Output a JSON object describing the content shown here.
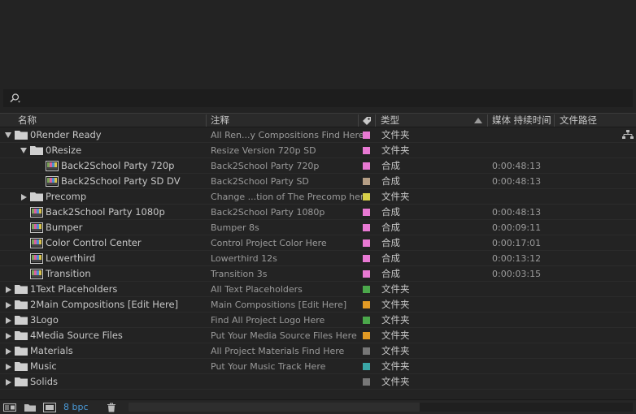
{
  "colors": {
    "pink": "#e879d3",
    "tan": "#b59e85",
    "yellow": "#d8d14a",
    "green": "#4ba84b",
    "orange": "#e29a24",
    "gray": "#777777",
    "teal": "#3aa6a6"
  },
  "header": {
    "name": "名称",
    "comment": "注释",
    "type": "类型",
    "duration": "媒体 持续时间",
    "path": "文件路径"
  },
  "rows": [
    {
      "depth": 0,
      "expand": "open",
      "kind": "folder",
      "name": "0Render Ready",
      "comment": "All Ren...y Compositions Find Here",
      "color": "pink",
      "type": "文件夹",
      "duration": ""
    },
    {
      "depth": 1,
      "expand": "open",
      "kind": "folder",
      "name": "0Resize",
      "comment": "Resize Version 720p SD",
      "color": "pink",
      "type": "文件夹",
      "duration": ""
    },
    {
      "depth": 2,
      "expand": "none",
      "kind": "comp",
      "name": "Back2School Party 720p",
      "comment": "Back2School Party 720p",
      "color": "pink",
      "type": "合成",
      "duration": "0:00:48:13"
    },
    {
      "depth": 2,
      "expand": "none",
      "kind": "comp",
      "name": "Back2School Party SD DV",
      "comment": "Back2School Party SD",
      "color": "tan",
      "type": "合成",
      "duration": "0:00:48:13"
    },
    {
      "depth": 1,
      "expand": "closed",
      "kind": "folder",
      "name": "Precomp",
      "comment": "Change ...tion of The Precomp here",
      "color": "yellow",
      "type": "文件夹",
      "duration": ""
    },
    {
      "depth": 1,
      "expand": "none",
      "kind": "comp",
      "name": "Back2School Party 1080p",
      "comment": "Back2School Party 1080p",
      "color": "pink",
      "type": "合成",
      "duration": "0:00:48:13"
    },
    {
      "depth": 1,
      "expand": "none",
      "kind": "comp",
      "name": "Bumper",
      "comment": "Bumper 8s",
      "color": "pink",
      "type": "合成",
      "duration": "0:00:09:11"
    },
    {
      "depth": 1,
      "expand": "none",
      "kind": "comp",
      "name": "Color Control Center",
      "comment": "Control Project Color Here",
      "color": "pink",
      "type": "合成",
      "duration": "0:00:17:01"
    },
    {
      "depth": 1,
      "expand": "none",
      "kind": "comp",
      "name": "Lowerthird",
      "comment": "Lowerthird 12s",
      "color": "pink",
      "type": "合成",
      "duration": "0:00:13:12"
    },
    {
      "depth": 1,
      "expand": "none",
      "kind": "comp",
      "name": "Transition",
      "comment": "Transition 3s",
      "color": "pink",
      "type": "合成",
      "duration": "0:00:03:15"
    },
    {
      "depth": 0,
      "expand": "closed",
      "kind": "folder",
      "name": "1Text Placeholders",
      "comment": "All Text Placeholders",
      "color": "green",
      "type": "文件夹",
      "duration": ""
    },
    {
      "depth": 0,
      "expand": "closed",
      "kind": "folder",
      "name": "2Main Compositions [Edit Here]",
      "comment": "Main Compositions [Edit Here]",
      "color": "orange",
      "type": "文件夹",
      "duration": ""
    },
    {
      "depth": 0,
      "expand": "closed",
      "kind": "folder",
      "name": "3Logo",
      "comment": "Find All Project Logo Here",
      "color": "green",
      "type": "文件夹",
      "duration": ""
    },
    {
      "depth": 0,
      "expand": "closed",
      "kind": "folder",
      "name": "4Media Source Files",
      "comment": "Put Your Media Source Files Here",
      "color": "orange",
      "type": "文件夹",
      "duration": ""
    },
    {
      "depth": 0,
      "expand": "closed",
      "kind": "folder",
      "name": "Materials",
      "comment": "All Project Materials Find Here",
      "color": "gray",
      "type": "文件夹",
      "duration": ""
    },
    {
      "depth": 0,
      "expand": "closed",
      "kind": "folder",
      "name": "Music",
      "comment": "Put Your Music Track Here",
      "color": "teal",
      "type": "文件夹",
      "duration": ""
    },
    {
      "depth": 0,
      "expand": "closed",
      "kind": "folder",
      "name": "Solids",
      "comment": "",
      "color": "gray",
      "type": "文件夹",
      "duration": ""
    }
  ],
  "footer": {
    "bit_depth": "8 bpc",
    "icons": [
      "interpret-footage-icon",
      "new-folder-icon",
      "new-composition-icon",
      "trash-icon"
    ]
  }
}
